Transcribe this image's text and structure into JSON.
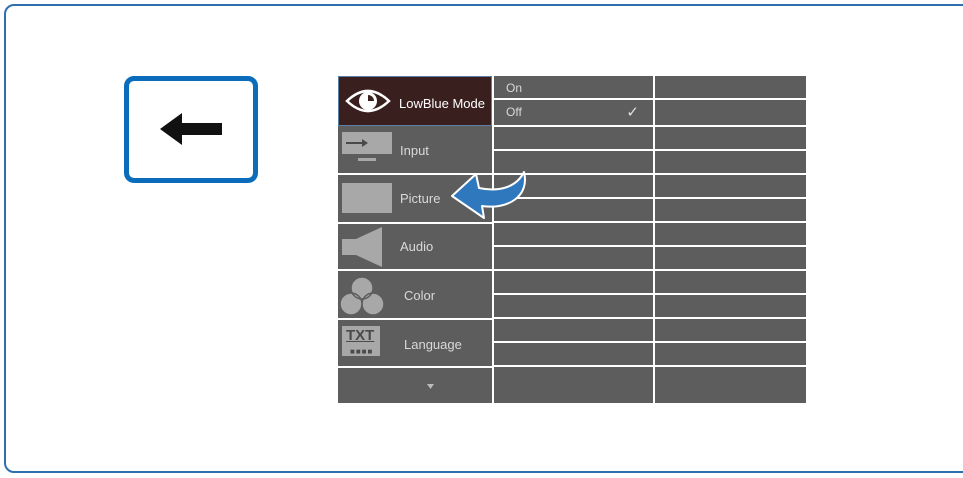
{
  "back_button": {
    "icon": "left-arrow-icon"
  },
  "osd": {
    "main_menu": [
      {
        "label": "LowBlue Mode",
        "icon": "eye-icon",
        "selected": true
      },
      {
        "label": "Input",
        "icon": "input-icon"
      },
      {
        "label": "Picture",
        "icon": "picture-icon"
      },
      {
        "label": "Audio",
        "icon": "speaker-icon"
      },
      {
        "label": "Color",
        "icon": "color-icon"
      },
      {
        "label": "Language",
        "icon": "language-icon",
        "icon_text": "TXT"
      },
      {
        "label": "",
        "icon": "chevron-down-icon"
      }
    ],
    "submenu": {
      "options": [
        {
          "label": "On",
          "checked": false
        },
        {
          "label": "Off",
          "checked": true
        }
      ],
      "check_glyph": "✓"
    }
  },
  "colors": {
    "frame_border": "#2e6fad",
    "back_border": "#0a6cba",
    "osd_gray": "#5d5d5d",
    "selected_bg": "#3a1f1f",
    "return_arrow": "#2f78bd"
  }
}
